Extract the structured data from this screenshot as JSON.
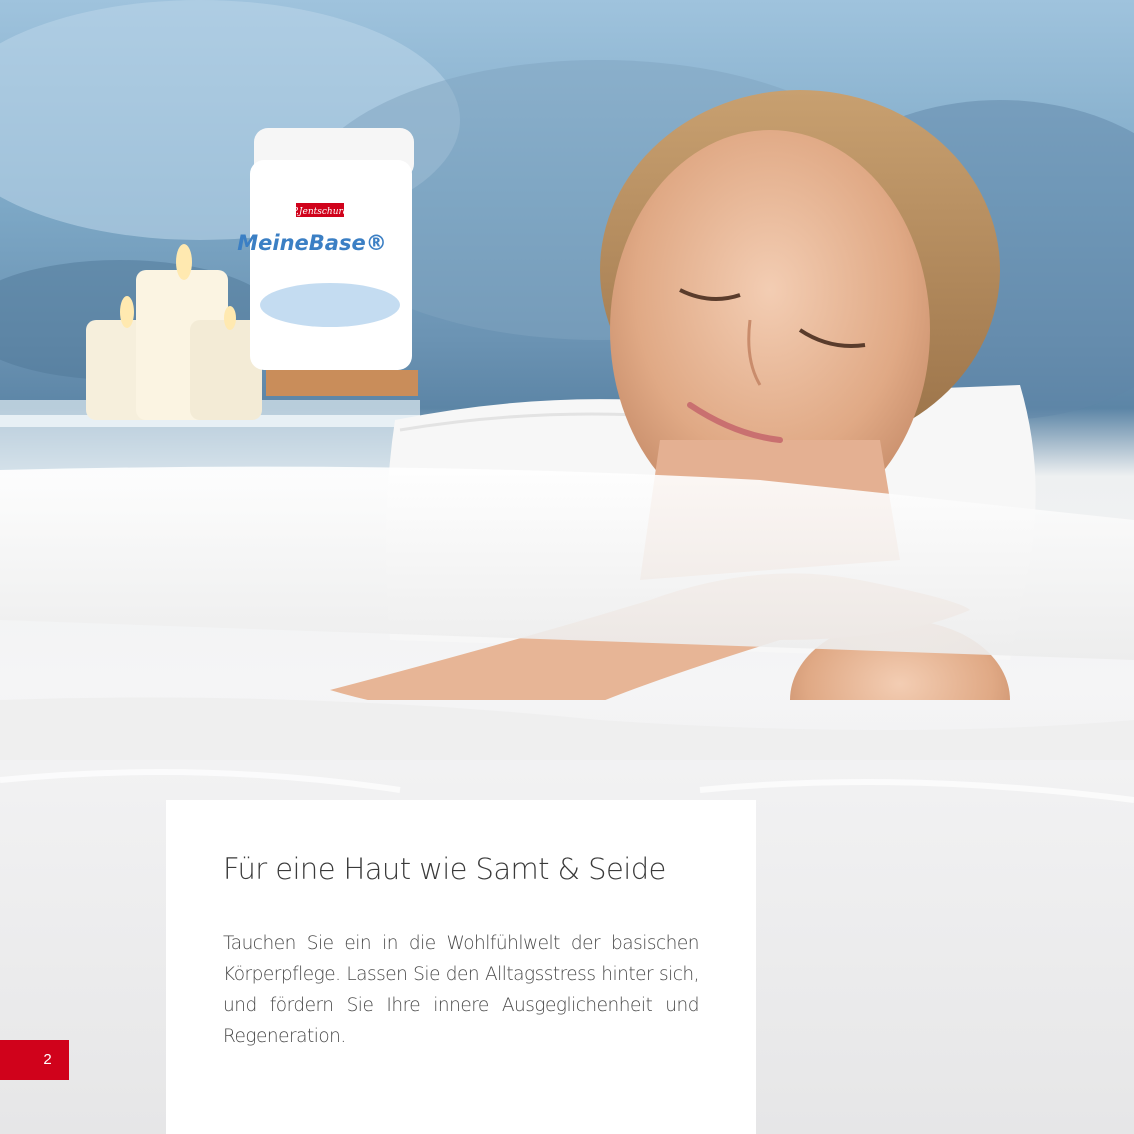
{
  "product": {
    "brand": "P.Jentschura",
    "name": "MeineBase®"
  },
  "text_card": {
    "title": "Für eine Haut wie Samt & Seide",
    "body": "Tauchen Sie ein in die Wohlfühlwelt der basischen Körperpflege. Lassen Sie den Alltagsstress hinter sich, und fördern Sie Ihre innere Ausgeglichenheit und Regeneration."
  },
  "page_number": "2",
  "colors": {
    "accent": "#d0021b",
    "card_bg": "#ffffff",
    "text": "#3a3a3a"
  }
}
